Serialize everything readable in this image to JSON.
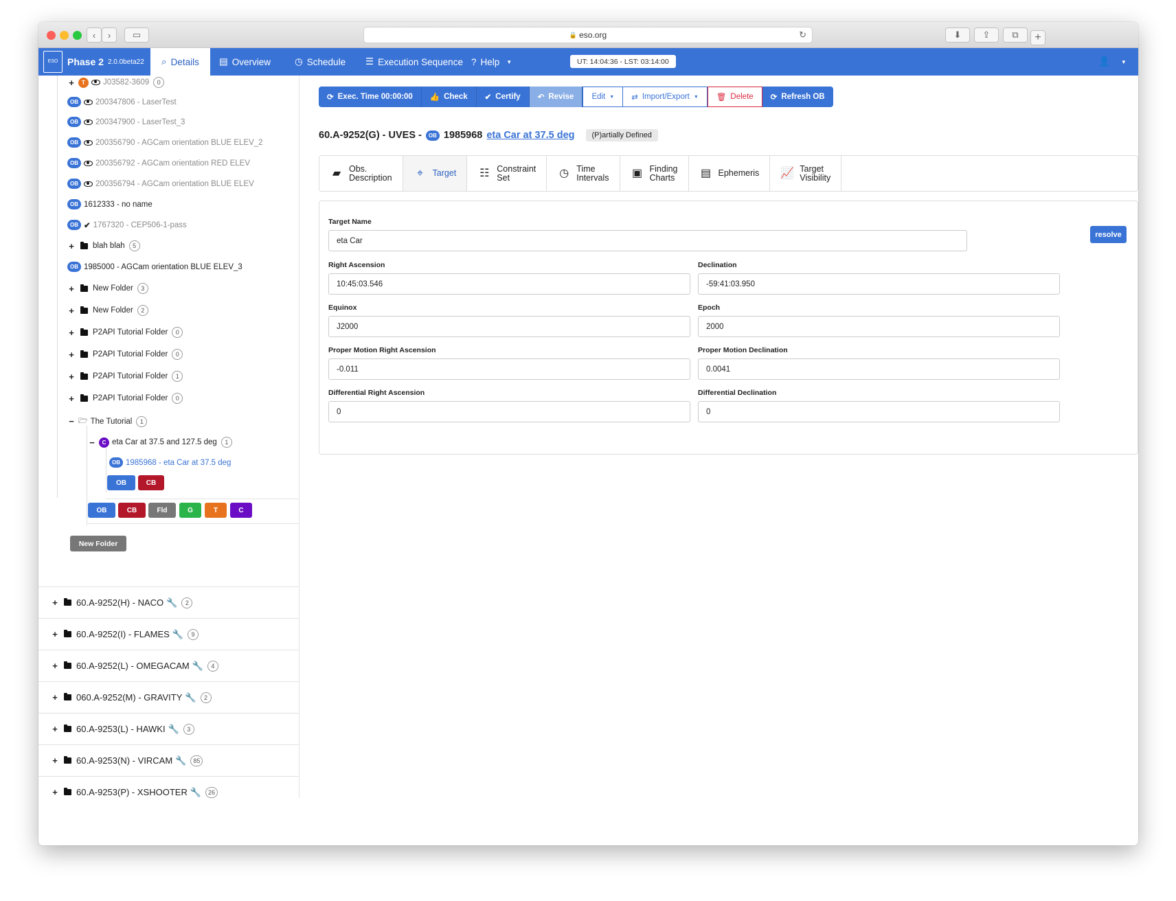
{
  "browser": {
    "url": "eso.org"
  },
  "nav": {
    "app_title": "Phase 2",
    "version": "2.0.0beta22",
    "logo_text": "ESO",
    "items": [
      {
        "label": "Details",
        "icon": "search-icon"
      },
      {
        "label": "Overview",
        "icon": "overview-icon"
      },
      {
        "label": "Schedule",
        "icon": "clock-icon"
      },
      {
        "label": "Execution Sequence",
        "icon": "list-icon"
      },
      {
        "label": "Help",
        "icon": "question-icon"
      }
    ],
    "clock": "UT: 14:04:36 - LST: 03:14:00"
  },
  "tree": {
    "nodes": [
      {
        "badge": "T",
        "label": "J03582-3609",
        "count": "0"
      },
      {
        "badge": "OB",
        "label": "200347806 - LaserTest"
      },
      {
        "badge": "OB",
        "label": "200347900 - LaserTest_3"
      },
      {
        "badge": "OB",
        "label": "200356790 - AGCam orientation BLUE ELEV_2"
      },
      {
        "badge": "OB",
        "label": "200356792 - AGCam orientation RED ELEV"
      },
      {
        "badge": "OB",
        "label": "200356794 - AGCam orientation BLUE ELEV"
      },
      {
        "badge": "OB",
        "label": "1612333 - no name"
      },
      {
        "badge": "OB",
        "label": "1767320 - CEP506-1-pass"
      },
      {
        "label": "blah blah",
        "count": "5"
      },
      {
        "badge": "OB",
        "label": "1985000 - AGCam orientation BLUE ELEV_3"
      },
      {
        "label": "New Folder",
        "count": "3"
      },
      {
        "label": "New Folder",
        "count": "2"
      },
      {
        "label": "P2API Tutorial Folder",
        "count": "0"
      },
      {
        "label": "P2API Tutorial Folder",
        "count": "0"
      },
      {
        "label": "P2API Tutorial Folder",
        "count": "1"
      },
      {
        "label": "P2API Tutorial Folder",
        "count": "0"
      },
      {
        "label": "The Tutorial",
        "count": "1"
      },
      {
        "badge": "C",
        "label": "eta Car at 37.5 and 127.5 deg",
        "count": "1"
      },
      {
        "badge": "OB",
        "label": "1985968 - eta Car at 37.5 deg"
      }
    ],
    "inner_buttons": [
      "OB",
      "CB"
    ],
    "type_buttons": [
      "OB",
      "CB",
      "Fld",
      "G",
      "T",
      "C"
    ],
    "new_folder": "New Folder",
    "programs": [
      {
        "label": "60.A-9252(H) - NACO",
        "count": "2"
      },
      {
        "label": "60.A-9252(I) - FLAMES",
        "count": "9"
      },
      {
        "label": "60.A-9252(L) - OMEGACAM",
        "count": "4"
      },
      {
        "label": "060.A-9252(M) - GRAVITY",
        "count": "2"
      },
      {
        "label": "60.A-9253(L) - HAWKI",
        "count": "3"
      },
      {
        "label": "60.A-9253(N) - VIRCAM",
        "count": "85"
      },
      {
        "label": "60.A-9253(P) - XSHOOTER",
        "count": "26"
      }
    ]
  },
  "toolbar": {
    "exec_time": "Exec. Time 00:00:00",
    "check": "Check",
    "certify": "Certify",
    "revise": "Revise",
    "edit": "Edit",
    "import_export": "Import/Export",
    "delete": "Delete",
    "refresh": "Refresh OB"
  },
  "ob": {
    "run": "60.A-9252(G) - UVES -",
    "badge": "OB",
    "id": "1985968",
    "name": "eta Car at 37.5 deg",
    "status": "(P)artially Defined"
  },
  "tabs": [
    {
      "l1": "Obs.",
      "l2": "Description"
    },
    {
      "l1": "Target",
      "l2": ""
    },
    {
      "l1": "Constraint",
      "l2": "Set"
    },
    {
      "l1": "Time",
      "l2": "Intervals"
    },
    {
      "l1": "Finding",
      "l2": "Charts"
    },
    {
      "l1": "Ephemeris",
      "l2": ""
    },
    {
      "l1": "Target",
      "l2": "Visibility"
    }
  ],
  "form": {
    "target_name": {
      "label": "Target Name",
      "value": "eta Car"
    },
    "resolve": "resolve",
    "ra": {
      "label": "Right Ascension",
      "value": "10:45:03.546"
    },
    "dec": {
      "label": "Declination",
      "value": "-59:41:03.950"
    },
    "equinox": {
      "label": "Equinox",
      "value": "J2000"
    },
    "epoch": {
      "label": "Epoch",
      "value": "2000"
    },
    "pm_ra": {
      "label": "Proper Motion Right Ascension",
      "value": "-0.011"
    },
    "pm_dec": {
      "label": "Proper Motion Declination",
      "value": "0.0041"
    },
    "diff_ra": {
      "label": "Differential Right Ascension",
      "value": "0"
    },
    "diff_dec": {
      "label": "Differential Declination",
      "value": "0"
    }
  },
  "colors": {
    "primary": "#3a73d6",
    "cb": "#b3172a",
    "fld": "#777777",
    "g": "#2bb44a",
    "t": "#e8731e",
    "c": "#6a0dc4",
    "delete": "#d9293e"
  }
}
